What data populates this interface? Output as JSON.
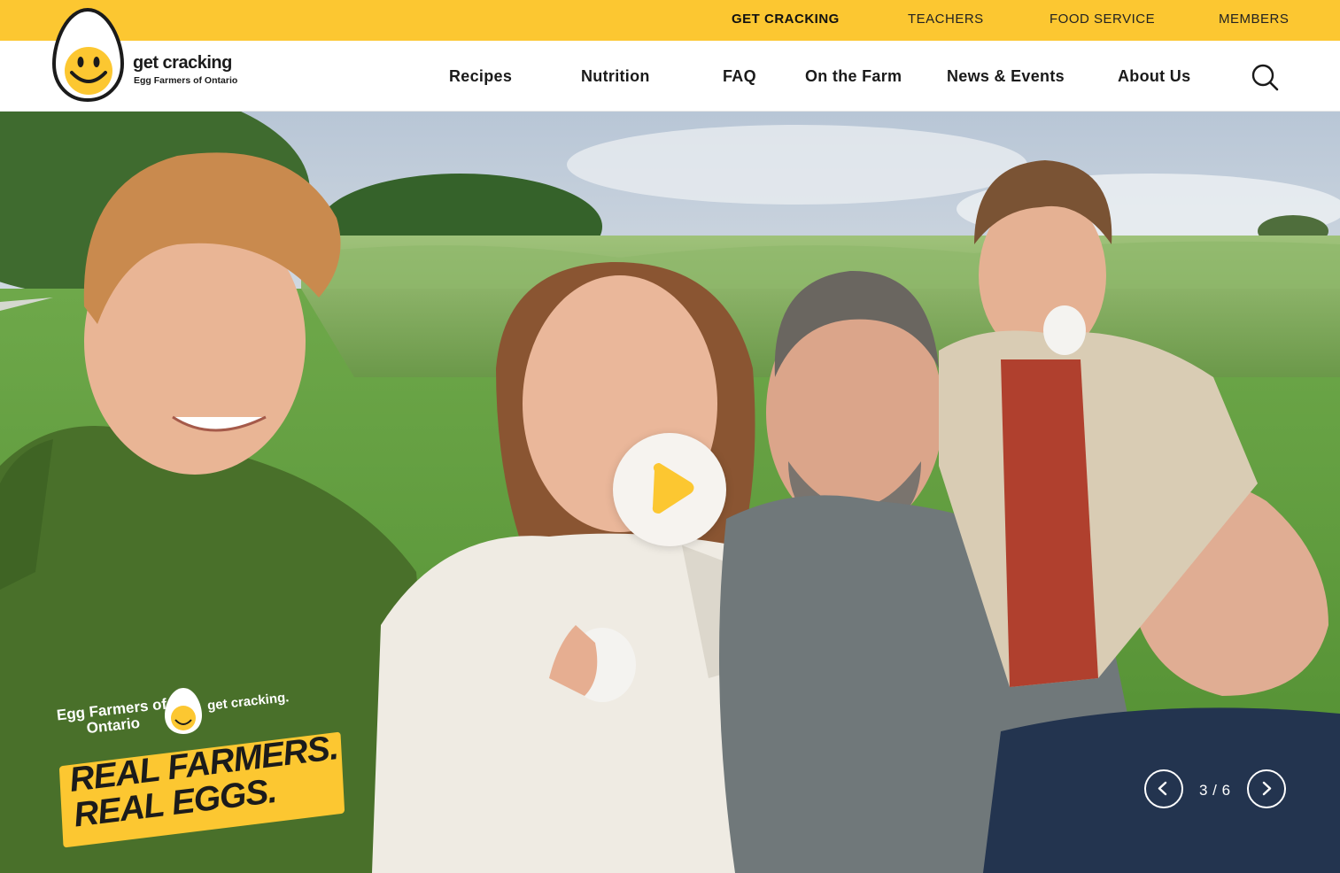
{
  "utility_nav": {
    "items": [
      {
        "label": "GET CRACKING",
        "active": true
      },
      {
        "label": "TEACHERS",
        "active": false
      },
      {
        "label": "FOOD SERVICE",
        "active": false
      },
      {
        "label": "MEMBERS",
        "active": false
      }
    ]
  },
  "brand": {
    "name": "get cracking",
    "subtitle": "Egg Farmers of Ontario",
    "color_primary": "#fcc731",
    "color_dark": "#1b1b1b"
  },
  "main_nav": {
    "items": [
      {
        "label": "Recipes"
      },
      {
        "label": "Nutrition"
      },
      {
        "label": "FAQ"
      },
      {
        "label": "On the Farm"
      },
      {
        "label": "News & Events"
      },
      {
        "label": "About Us"
      }
    ],
    "search_icon": "search-icon"
  },
  "hero": {
    "play_icon": "play-icon",
    "shirt_print": {
      "brand_left": "Egg Farmers of Ontario",
      "brand_right": "get cracking.",
      "tagline": "REAL FARMERS. REAL EGGS."
    },
    "carousel": {
      "counter": "3 / 6",
      "prev_icon": "chevron-left-icon",
      "next_icon": "chevron-right-icon"
    }
  }
}
